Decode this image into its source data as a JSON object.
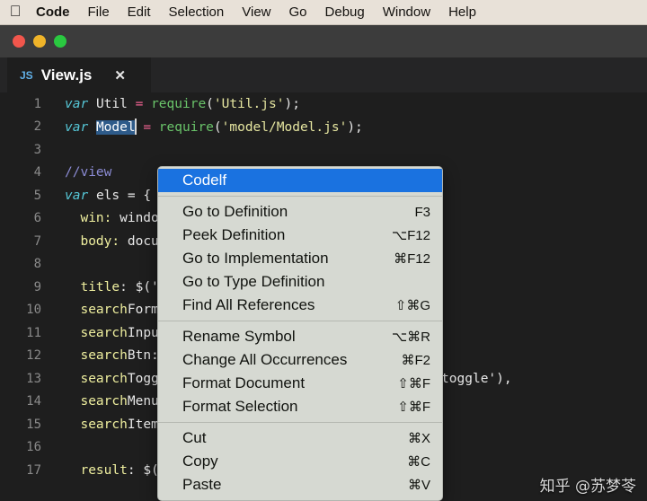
{
  "menubar": {
    "apple_icon": "apple-logo-icon",
    "items": [
      {
        "label": "Code",
        "bold": true
      },
      {
        "label": "File",
        "bold": false
      },
      {
        "label": "Edit",
        "bold": false
      },
      {
        "label": "Selection",
        "bold": false
      },
      {
        "label": "View",
        "bold": false
      },
      {
        "label": "Go",
        "bold": false
      },
      {
        "label": "Debug",
        "bold": false
      },
      {
        "label": "Window",
        "bold": false
      },
      {
        "label": "Help",
        "bold": false
      }
    ]
  },
  "window": {
    "traffic_lights": {
      "close_color": "#f1564c",
      "minimize_color": "#f0b429",
      "maximize_color": "#2ac940"
    }
  },
  "tab": {
    "file_type": "JS",
    "filename": "View.js",
    "close_glyph": "✕"
  },
  "editor": {
    "background": "#1e1e1e",
    "selection_color": "#2e5b8a",
    "lines": [
      {
        "n": "1",
        "segments": [
          {
            "t": "var",
            "c": "kw"
          },
          {
            "t": " ",
            "c": "pun"
          },
          {
            "t": "Util",
            "c": "var"
          },
          {
            "t": " ",
            "c": "pun"
          },
          {
            "t": "=",
            "c": "op"
          },
          {
            "t": " ",
            "c": "pun"
          },
          {
            "t": "require",
            "c": "fn"
          },
          {
            "t": "(",
            "c": "pun"
          },
          {
            "t": "'Util.js'",
            "c": "str"
          },
          {
            "t": ");",
            "c": "pun"
          }
        ]
      },
      {
        "n": "2",
        "segments": [
          {
            "t": "var",
            "c": "kw"
          },
          {
            "t": " ",
            "c": "pun"
          },
          {
            "t": "Model",
            "c": "sel"
          },
          {
            "t": "\u0000cursor",
            "c": "cursor"
          },
          {
            "t": " ",
            "c": "pun"
          },
          {
            "t": "=",
            "c": "op"
          },
          {
            "t": " ",
            "c": "pun"
          },
          {
            "t": "require",
            "c": "fn"
          },
          {
            "t": "(",
            "c": "pun"
          },
          {
            "t": "'model/Model.js'",
            "c": "str"
          },
          {
            "t": ");",
            "c": "pun"
          }
        ]
      },
      {
        "n": "3",
        "segments": []
      },
      {
        "n": "4",
        "segments": [
          {
            "t": "//view",
            "c": "cmt"
          }
        ]
      },
      {
        "n": "5",
        "segments": [
          {
            "t": "var",
            "c": "kw"
          },
          {
            "t": " ",
            "c": "pun"
          },
          {
            "t": "els",
            "c": "var"
          },
          {
            "t": " = {",
            "c": "pun"
          }
        ]
      },
      {
        "n": "6",
        "segments": [
          {
            "t": "  ",
            "c": "pun"
          },
          {
            "t": "win:",
            "c": "prop"
          },
          {
            "t": " window,",
            "c": "pun"
          }
        ]
      },
      {
        "n": "7",
        "segments": [
          {
            "t": "  ",
            "c": "pun"
          },
          {
            "t": "body:",
            "c": "prop"
          },
          {
            "t": " document.body,",
            "c": "pun"
          }
        ]
      },
      {
        "n": "8",
        "segments": []
      },
      {
        "n": "9",
        "segments": [
          {
            "t": "  ",
            "c": "pun"
          },
          {
            "t": "title",
            "c": "prop"
          },
          {
            "t": ": $('title'),",
            "c": "pun"
          }
        ]
      },
      {
        "n": "10",
        "segments": [
          {
            "t": "  ",
            "c": "pun"
          },
          {
            "t": "search",
            "c": "prop"
          },
          {
            "t": "Form: $('#search-form'),",
            "c": "pun"
          }
        ]
      },
      {
        "n": "11",
        "segments": [
          {
            "t": "  ",
            "c": "pun"
          },
          {
            "t": "search",
            "c": "prop"
          },
          {
            "t": "Input: $('#search-input'),",
            "c": "pun"
          }
        ]
      },
      {
        "n": "12",
        "segments": [
          {
            "t": "  ",
            "c": "pun"
          },
          {
            "t": "search",
            "c": "prop"
          },
          {
            "t": "Btn: $('#btn-search'),",
            "c": "pun"
          }
        ]
      },
      {
        "n": "13",
        "segments": [
          {
            "t": "  ",
            "c": "pun"
          },
          {
            "t": "search",
            "c": "prop"
          },
          {
            "t": "Toggle: $('#search-form button.dropdown-toggle'),",
            "c": "pun"
          }
        ]
      },
      {
        "n": "14",
        "segments": [
          {
            "t": "  ",
            "c": "pun"
          },
          {
            "t": "search",
            "c": "prop"
          },
          {
            "t": "Menu: $('#search-form .dropdown-menu'),",
            "c": "pun"
          }
        ]
      },
      {
        "n": "15",
        "segments": [
          {
            "t": "  ",
            "c": "pun"
          },
          {
            "t": "search",
            "c": "prop"
          },
          {
            "t": "Items: $('#search-form .dropdown-menu sc",
            "c": "pun"
          }
        ]
      },
      {
        "n": "16",
        "segments": []
      },
      {
        "n": "17",
        "segments": [
          {
            "t": "  ",
            "c": "pun"
          },
          {
            "t": "result",
            "c": "prop"
          },
          {
            "t": ": $('#search-result'),",
            "c": "pun"
          }
        ]
      }
    ]
  },
  "context_menu": {
    "groups": [
      [
        {
          "label": "Codelf",
          "accel": "",
          "highlighted": true
        }
      ],
      [
        {
          "label": "Go to Definition",
          "accel": "F3",
          "highlighted": false
        },
        {
          "label": "Peek Definition",
          "accel": "⌥F12",
          "highlighted": false
        },
        {
          "label": "Go to Implementation",
          "accel": "⌘F12",
          "highlighted": false
        },
        {
          "label": "Go to Type Definition",
          "accel": "",
          "highlighted": false
        },
        {
          "label": "Find All References",
          "accel": "⇧⌘G",
          "highlighted": false
        }
      ],
      [
        {
          "label": "Rename Symbol",
          "accel": "⌥⌘R",
          "highlighted": false
        },
        {
          "label": "Change All Occurrences",
          "accel": "⌘F2",
          "highlighted": false
        },
        {
          "label": "Format Document",
          "accel": "⇧⌘F",
          "highlighted": false
        },
        {
          "label": "Format Selection",
          "accel": "⇧⌘F",
          "highlighted": false
        }
      ],
      [
        {
          "label": "Cut",
          "accel": "⌘X",
          "highlighted": false
        },
        {
          "label": "Copy",
          "accel": "⌘C",
          "highlighted": false
        },
        {
          "label": "Paste",
          "accel": "⌘V",
          "highlighted": false
        }
      ]
    ],
    "highlight_color": "#1a72e0"
  },
  "watermark": {
    "text": "知乎 @苏梦苓"
  }
}
